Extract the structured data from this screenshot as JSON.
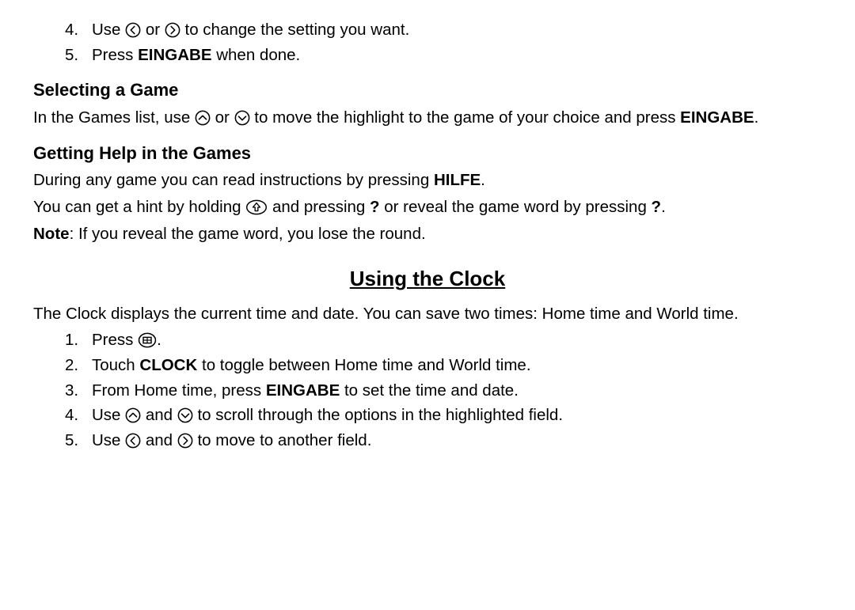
{
  "list_a": {
    "item4": {
      "num": "4.",
      "pre": "Use ",
      "mid": " or ",
      "post": " to change the setting you want."
    },
    "item5": {
      "num": "5.",
      "pre": "Press ",
      "bold": "EINGABE",
      "post": " when done."
    }
  },
  "selecting": {
    "heading": "Selecting a Game",
    "p_pre": "In the Games list, use ",
    "p_mid": " or ",
    "p_mid2": " to move the highlight to the game of your choice and press ",
    "p_bold": "EINGABE",
    "p_end": "."
  },
  "help": {
    "heading": "Getting Help in the Games",
    "p1_pre": "During any game you can read instructions by pressing ",
    "p1_bold": "HILFE",
    "p1_end": ".",
    "p2_pre": "You can get a hint by holding ",
    "p2_mid": " and pressing ",
    "p2_bold1": "?",
    "p2_mid2": " or reveal the game word by pressing ",
    "p2_bold2": "?",
    "p2_end": ".",
    "p3_bold": "Note",
    "p3_rest": ": If you reveal the game word, you lose the round."
  },
  "clock": {
    "heading": "Using the Clock",
    "intro": "The Clock displays the current time and date. You can save two times: Home time and World time.",
    "items": {
      "i1": {
        "num": "1.",
        "pre": "Press ",
        "post": "."
      },
      "i2": {
        "num": "2.",
        "pre": "Touch ",
        "bold": "CLOCK",
        "post": " to toggle between Home time and World time."
      },
      "i3": {
        "num": "3.",
        "pre": "From Home time, press ",
        "bold": "EINGABE",
        "post": " to set the time and date."
      },
      "i4": {
        "num": "4.",
        "pre": "Use ",
        "mid": " and ",
        "post": " to scroll through the options in the highlighted field."
      },
      "i5": {
        "num": "5.",
        "pre": "Use ",
        "mid": " and ",
        "post": " to move to another field."
      }
    }
  }
}
